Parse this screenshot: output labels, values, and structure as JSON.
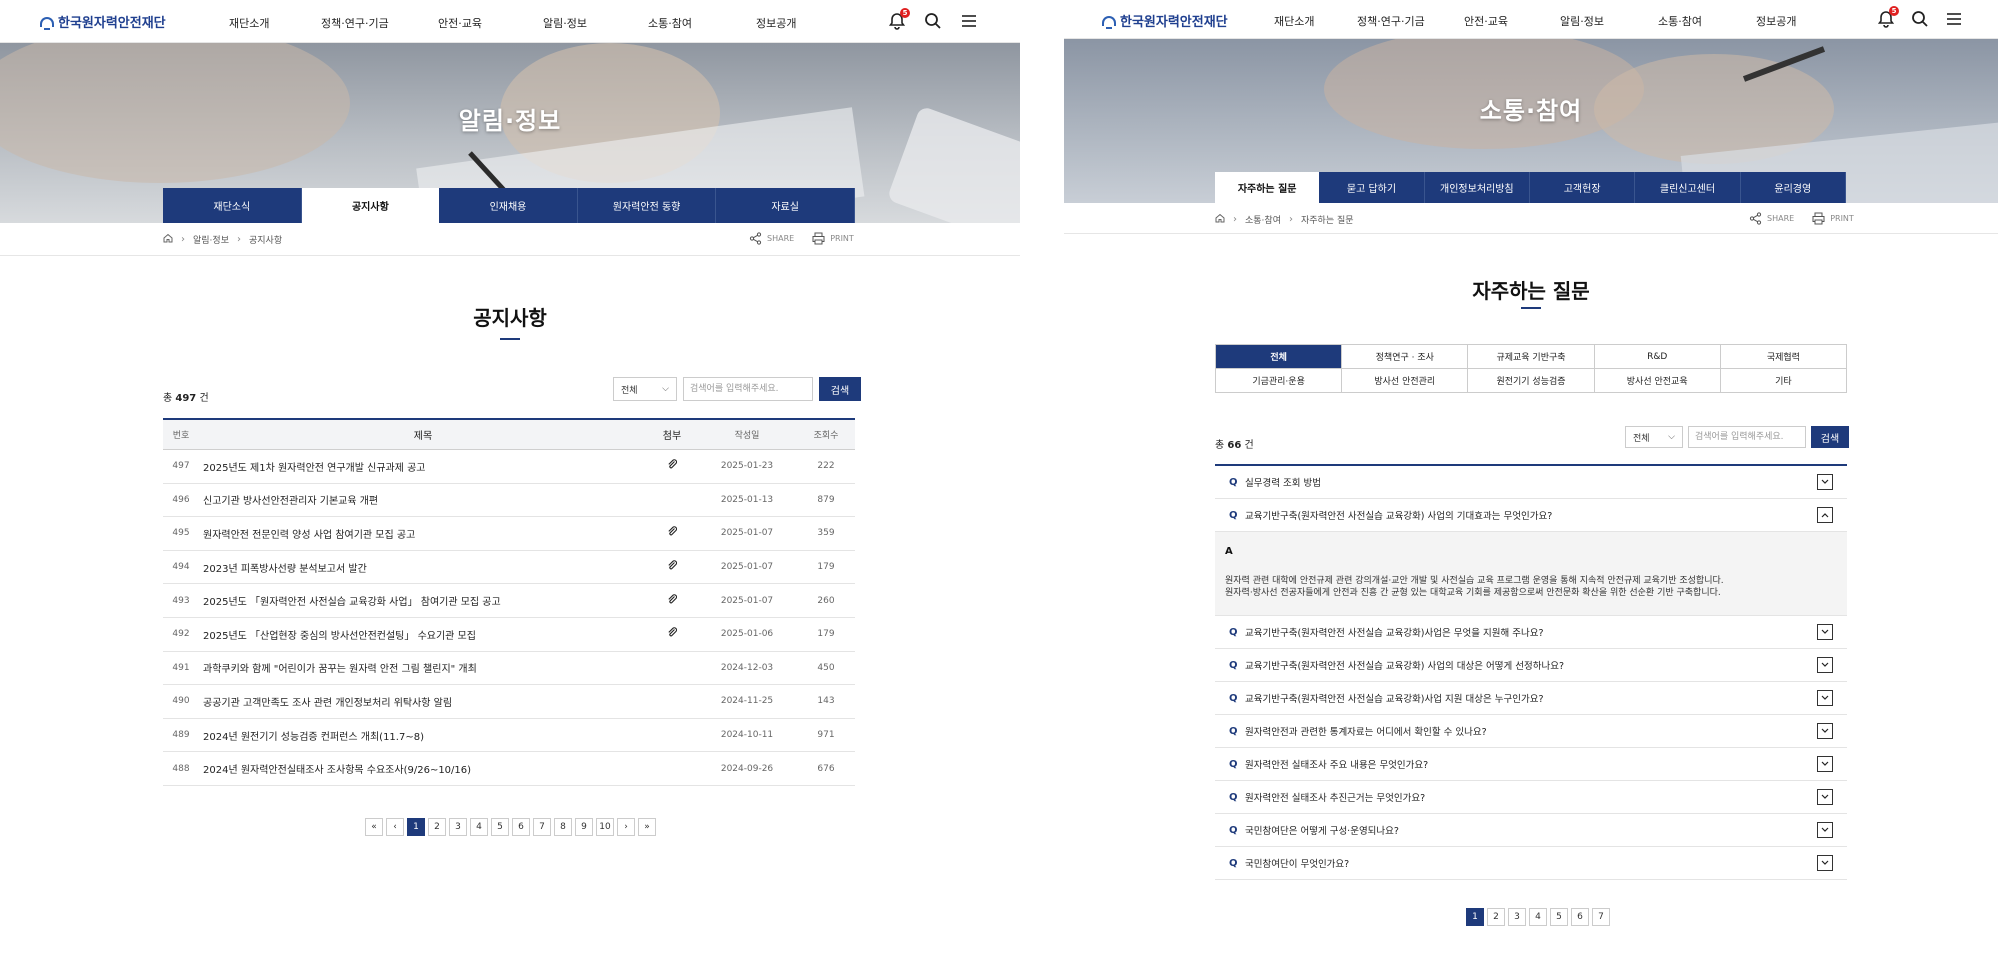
{
  "left": {
    "logo": "한국원자력안전재단",
    "menu": [
      "재단소개",
      "정책·연구·기금",
      "안전·교육",
      "알림·정보",
      "소통·참여",
      "정보공개"
    ],
    "bell_count": "5",
    "visual_title": "알림·정보",
    "tabs": [
      "재단소식",
      "공지사항",
      "인재채용",
      "원자력안전 동향",
      "자료실"
    ],
    "active_tab": 1,
    "breadcrumb": [
      "알림·정보",
      "공지사항"
    ],
    "share": "SHARE",
    "print": "PRINT",
    "page_title": "공지사항",
    "total_prefix": "총",
    "total_count": "497",
    "total_suffix": "건",
    "select_value": "전체",
    "search_placeholder": "검색어를 입력해주세요.",
    "search_button": "검색",
    "table_headers": [
      "번호",
      "제목",
      "첨부",
      "작성일",
      "조회수"
    ],
    "rows": [
      {
        "no": "497",
        "title": "2025년도 제1차 원자력안전 연구개발 신규과제 공고",
        "attach": true,
        "date": "2025-01-23",
        "views": "222"
      },
      {
        "no": "496",
        "title": "신고기관 방사선안전관리자 기본교육 개편",
        "attach": false,
        "date": "2025-01-13",
        "views": "879"
      },
      {
        "no": "495",
        "title": "원자력안전 전문인력 양성 사업 참여기관 모집 공고",
        "attach": true,
        "date": "2025-01-07",
        "views": "359"
      },
      {
        "no": "494",
        "title": "2023년 피폭방사선량 분석보고서 발간",
        "attach": true,
        "date": "2025-01-07",
        "views": "179"
      },
      {
        "no": "493",
        "title": "2025년도 「원자력안전 사전실습 교육강화 사업」 참여기관 모집 공고",
        "attach": true,
        "date": "2025-01-07",
        "views": "260"
      },
      {
        "no": "492",
        "title": "2025년도 「산업현장 중심의 방사선안전컨설팅」 수요기관 모집",
        "attach": true,
        "date": "2025-01-06",
        "views": "179"
      },
      {
        "no": "491",
        "title": "과학쿠키와 함께 \"어린이가 꿈꾸는 원자력 안전 그림 챌린지\" 개최",
        "attach": false,
        "date": "2024-12-03",
        "views": "450"
      },
      {
        "no": "490",
        "title": "공공기관 고객만족도 조사 관련 개인정보처리 위탁사항 알림",
        "attach": false,
        "date": "2024-11-25",
        "views": "143"
      },
      {
        "no": "489",
        "title": "2024년 원전기기 성능검증 컨퍼런스 개최(11.7~8)",
        "attach": false,
        "date": "2024-10-11",
        "views": "971"
      },
      {
        "no": "488",
        "title": "2024년 원자력안전실태조사 조사항목 수요조사(9/26~10/16)",
        "attach": false,
        "date": "2024-09-26",
        "views": "676"
      }
    ],
    "pages": [
      "1",
      "2",
      "3",
      "4",
      "5",
      "6",
      "7",
      "8",
      "9",
      "10"
    ],
    "nav": {
      "first": "«",
      "prev": "‹",
      "next": "›",
      "last": "»"
    }
  },
  "right": {
    "logo": "한국원자력안전재단",
    "menu": [
      "재단소개",
      "정책·연구·기금",
      "안전·교육",
      "알림·정보",
      "소통·참여",
      "정보공개"
    ],
    "bell_count": "5",
    "visual_title": "소통·참여",
    "tabs": [
      "자주하는 질문",
      "묻고 답하기",
      "개인정보처리방침",
      "고객헌장",
      "클린신고센터",
      "윤리경영"
    ],
    "active_tab": 0,
    "breadcrumb": [
      "소통·참여",
      "자주하는 질문"
    ],
    "share": "SHARE",
    "print": "PRINT",
    "page_title": "자주하는 질문",
    "categories": [
      "전체",
      "정책연구 · 조사",
      "규제교육 기반구축",
      "R&D",
      "국제협력",
      "기금관리·운용",
      "방사선 안전관리",
      "원전기기 성능검증",
      "방사선 안전교육",
      "기타"
    ],
    "active_category": 0,
    "total_prefix": "총",
    "total_count": "66",
    "total_suffix": "건",
    "select_value": "전체",
    "search_placeholder": "검색어를 입력해주세요.",
    "search_button": "검색",
    "q_label": "Q",
    "a_label": "A",
    "faqs": [
      {
        "q": "실무경력 조회 방법",
        "open": false
      },
      {
        "q": "교육기반구축(원자력안전 사전실습 교육강화) 사업의 기대효과는 무엇인가요?",
        "open": true,
        "answer": [
          "원자력 관련 대학에 안전규제 관련 강의개설·교안 개발 및 사전실습 교육 프로그램 운영을 통해 지속적 안전규제 교육기반 조성합니다.",
          "원자력·방사선 전공자들에게 안전과 진흥 간 균형 있는 대학교육 기회를 제공함으로써 안전문화 확산을 위한 선순환 기반 구축합니다."
        ]
      },
      {
        "q": "교육기반구축(원자력안전 사전실습 교육강화)사업은 무엇을 지원해 주나요?",
        "open": false
      },
      {
        "q": "교육기반구축(원자력안전 사전실습 교육강화) 사업의 대상은 어떻게 선정하나요?",
        "open": false
      },
      {
        "q": "교육기반구축(원자력안전 사전실습 교육강화)사업 지원 대상은 누구인가요?",
        "open": false
      },
      {
        "q": "원자력안전과 관련한 통계자료는 어디에서 확인할 수 있나요?",
        "open": false
      },
      {
        "q": "원자력안전 실태조사 주요 내용은 무엇인가요?",
        "open": false
      },
      {
        "q": "원자력안전 실태조사 추진근거는 무엇인가요?",
        "open": false
      },
      {
        "q": "국민참여단은 어떻게 구성·운영되나요?",
        "open": false
      },
      {
        "q": "국민참여단이 무엇인가요?",
        "open": false
      }
    ],
    "pages": [
      "1",
      "2",
      "3",
      "4",
      "5",
      "6",
      "7"
    ]
  },
  "colors": {
    "navy": "#1e3a7b",
    "badge": "#e02020",
    "logo": "#1f3f8f"
  }
}
